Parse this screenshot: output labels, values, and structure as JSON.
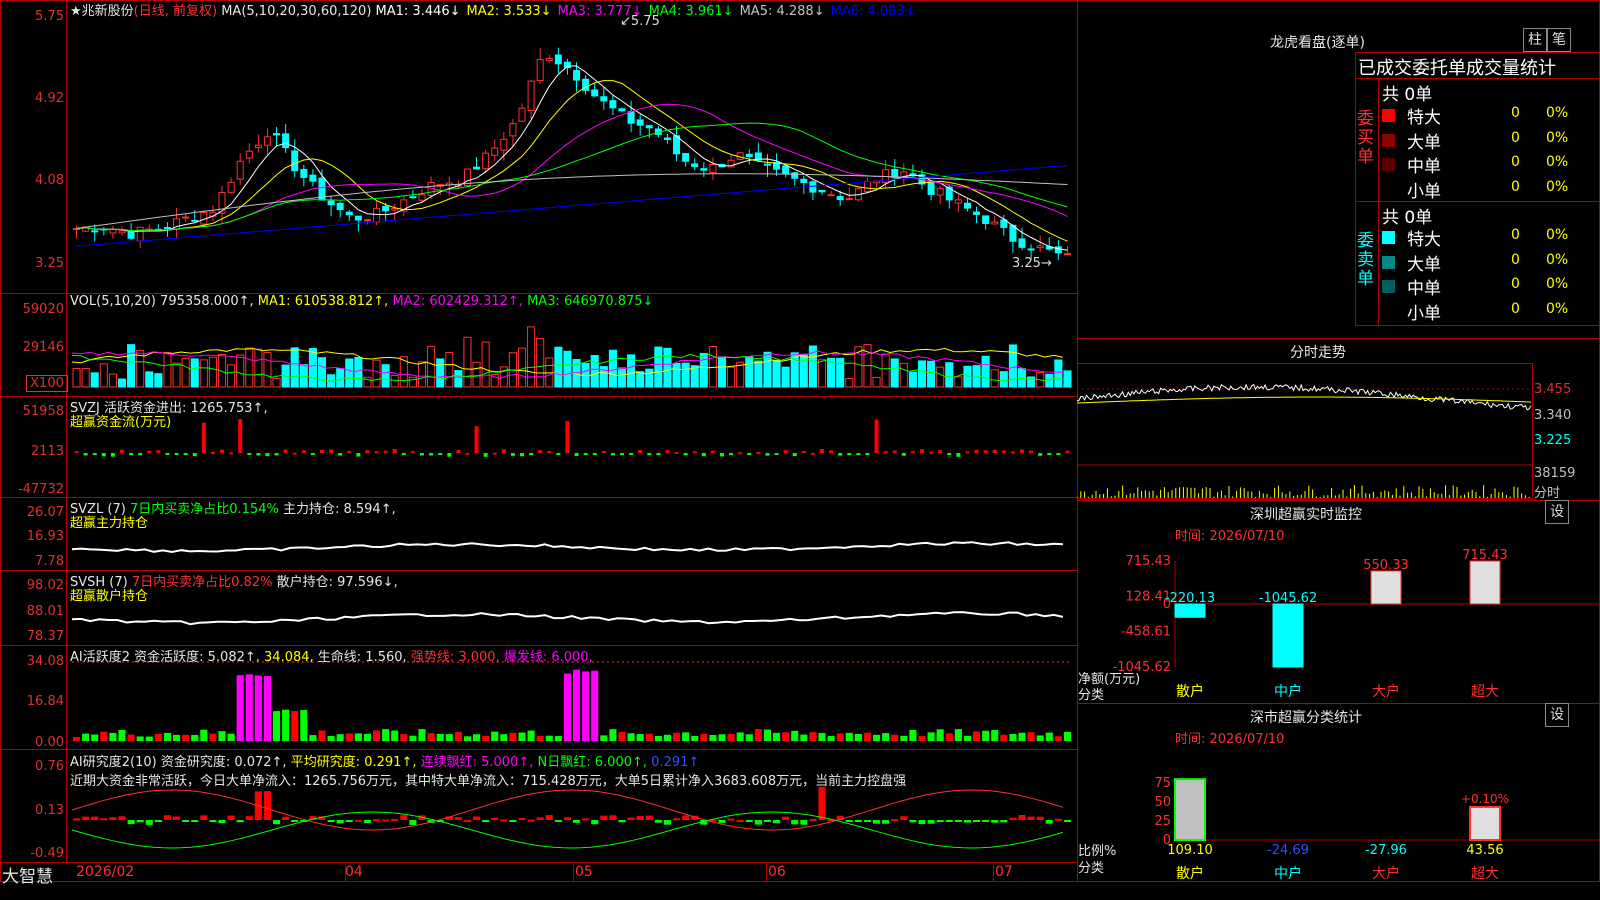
{
  "main": {
    "title": "★兆新股份",
    "period_label": "(日线, 前复权)",
    "ma_label": "MA(5,10,20,30,60,120)",
    "ma_values": [
      {
        "label": "MA1:",
        "value": "3.446↓",
        "color": "#ffffff"
      },
      {
        "label": "MA2:",
        "value": "3.533↓",
        "color": "#ffff00"
      },
      {
        "label": "MA3:",
        "value": "3.777↓",
        "color": "#ff00ff"
      },
      {
        "label": "MA4:",
        "value": "3.961↓",
        "color": "#00ff00"
      },
      {
        "label": "MA5:",
        "value": "4.288↓",
        "color": "#c0c0c0"
      },
      {
        "label": "MA6:",
        "value": "4.083↓",
        "color": "#0000ff"
      }
    ],
    "y_ticks": [
      "5.75",
      "4.92",
      "4.08",
      "3.25"
    ],
    "high_label": "5.75",
    "low_label": "3.25"
  },
  "vol": {
    "header": "VOL(5,10,20)",
    "value": "795358.000↑,",
    "ma1": "MA1: 610538.812↑,",
    "ma2": "MA2: 602429.312↑,",
    "ma3": "MA3: 646970.875↓",
    "y_ticks": [
      "59020",
      "29146"
    ],
    "unit": "X100"
  },
  "svzj": {
    "header": "SVZJ  活跃资金进出: 1265.753↑,",
    "sub": "超赢资金流(万元)",
    "y_ticks": [
      "51958",
      "2113",
      "-47732"
    ]
  },
  "svzl": {
    "header": "SVZL (7)",
    "pct": "7日内买卖净占比0.154%",
    "hold": "主力持仓: 8.594↑,",
    "sub": "超赢主力持仓",
    "y_ticks": [
      "26.07",
      "16.93",
      "7.78"
    ]
  },
  "svsh": {
    "header": "SVSH (7)",
    "pct": "7日内买卖净占比0.82%",
    "hold": "散户持仓: 97.596↓,",
    "sub": "超赢散户持仓",
    "y_ticks": [
      "98.02",
      "88.01",
      "78.37"
    ]
  },
  "ai1": {
    "header": "AI活跃度2 资金活跃度: 5.082↑,",
    "v2": "34.084,",
    "life": "生命线: 1.560,",
    "strong": "强势线: 3.000,",
    "burst": "爆发线: 6.000,",
    "y_ticks": [
      "34.08",
      "16.84",
      "0.00"
    ]
  },
  "ai2": {
    "header": "AI研究度2(10) 资金研究度: 0.072↑,",
    "avg": "平均研究度: 0.291↑,",
    "cont": "连续飘红: 5.000↑,",
    "nday": "N日飘红: 6.000↑,",
    "last": "0.291↑",
    "comment": "近期大资金非常活跃，今日大单净流入：1265.756万元，其中特大单净流入：715.428万元，大单5日累计净入3683.608万元，当前主力控盘强",
    "y_ticks": [
      "0.76",
      "0.13",
      "-0.49"
    ]
  },
  "xaxis": {
    "brand": "大智慧",
    "labels": [
      "2026/02",
      "04",
      "05",
      "06",
      "07"
    ]
  },
  "right": {
    "lhb_title": "龙虎看盘(逐单)",
    "tab_bar": "柱",
    "tab_pen": "笔",
    "order_title": "已成交委托单成交量统计",
    "buy_side": "委买单",
    "sell_side": "委卖单",
    "buy_total": "共 0单",
    "sell_total": "共 0单",
    "buy_rows": [
      {
        "label": "特大",
        "val": "0",
        "pct": "0%",
        "color": "#ff0000"
      },
      {
        "label": "大单",
        "val": "0",
        "pct": "0%",
        "color": "#8b0000"
      },
      {
        "label": "中单",
        "val": "0",
        "pct": "0%",
        "color": "#5a0000"
      },
      {
        "label": "小单",
        "val": "0",
        "pct": "0%",
        "color": "#000000"
      }
    ],
    "sell_rows": [
      {
        "label": "特大",
        "val": "0",
        "pct": "0%",
        "color": "#00ffff"
      },
      {
        "label": "大单",
        "val": "0",
        "pct": "0%",
        "color": "#008b8b"
      },
      {
        "label": "中单",
        "val": "0",
        "pct": "0%",
        "color": "#006060"
      },
      {
        "label": "小单",
        "val": "0",
        "pct": "0%",
        "color": "#000000"
      }
    ],
    "intraday_title": "分时走势",
    "intraday_ticks": [
      "3.455",
      "3.340",
      "3.225"
    ],
    "intraday_vol": "38159",
    "intraday_label": "分时",
    "monitor_title": "深圳超赢实时监控",
    "monitor_time": "时间: 2026/07/10",
    "monitor_set": "设",
    "monitor_ticks": [
      "715.43",
      "128.41",
      "0",
      "-458.61",
      "-1045.62"
    ],
    "monitor_unit": "净额(万元)",
    "monitor_cat": "分类",
    "classify_title": "深市超赢分类统计",
    "classify_time": "时间: 2026/07/10",
    "classify_set": "设",
    "classify_ticks": [
      "75",
      "50",
      "25",
      "0"
    ],
    "classify_unit": "比例%",
    "classify_cat": "分类"
  },
  "chart_data": [
    {
      "type": "bar",
      "title": "深圳超赢实时监控",
      "categories": [
        "散户",
        "中户",
        "大户",
        "超大"
      ],
      "values": [
        -220.13,
        -1045.62,
        550.33,
        715.43
      ],
      "ylim": [
        -1045.62,
        715.43
      ]
    },
    {
      "type": "bar",
      "title": "深市超赢分类统计",
      "categories": [
        "散户",
        "中户",
        "大户",
        "超大"
      ],
      "values": [
        109.1,
        -24.69,
        -27.96,
        43.56
      ],
      "extra_label": "+0.10%",
      "ylim": [
        0,
        75
      ]
    }
  ]
}
